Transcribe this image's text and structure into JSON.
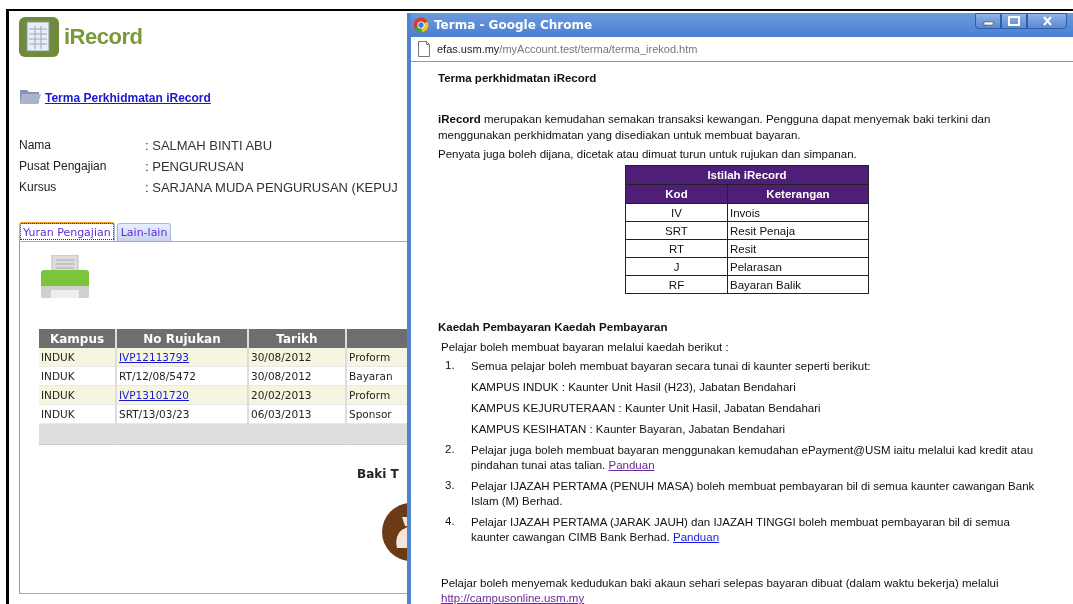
{
  "main_page": {
    "app_title": "iRecord",
    "terms_link": "Terma Perkhidmatan iRecord",
    "profile": [
      {
        "label": "Nama",
        "value": ": SALMAH BINTI ABU"
      },
      {
        "label": "Pusat Pengajian",
        "value": ": PENGURUSAN"
      },
      {
        "label": "Kursus",
        "value": ": SARJANA MUDA PENGURUSAN (KEPUJ"
      }
    ],
    "tabs": [
      {
        "label": "Yuran Pengajian",
        "selected": true
      },
      {
        "label": "Lain-lain",
        "selected": false
      }
    ],
    "table": {
      "columns": [
        "Kampus",
        "No Rujukan",
        "Tarikh"
      ],
      "rows": [
        {
          "cells": [
            "INDUK",
            "IVP12113793",
            "30/08/2012",
            "Proform"
          ],
          "kind": "link"
        },
        {
          "cells": [
            "INDUK",
            "RT/12/08/5472",
            "30/08/2012",
            "Bayaran"
          ],
          "kind": "text"
        },
        {
          "cells": [
            "INDUK",
            "IVP13101720",
            "20/02/2013",
            "Proform"
          ],
          "kind": "link"
        },
        {
          "cells": [
            "INDUK",
            "SRT/13/03/23",
            "06/03/2013",
            "Sponsor"
          ],
          "kind": "text"
        }
      ]
    },
    "balance_label": "Baki T"
  },
  "popup": {
    "title": "Terma - Google Chrome",
    "url_host": "efas.usm.my",
    "url_path": "/myAccount.test/terma/terma_irekod.htm",
    "heading": "Terma perkhidmatan iRecord",
    "intro": "**iRecord** merupakan kemudahan semakan transaksi kewangan. Pengguna dapat menyemak baki terkini dan menggunakan perkhidmatan yang disediakan untuk membuat bayaran.",
    "intro_2": "Penyata juga boleh dijana, dicetak atau dimuat turun untuk rujukan dan simpanan.",
    "terms_table": {
      "title": "Istilah iRecord",
      "columns": [
        "Kod",
        "Keterangan"
      ],
      "rows": [
        [
          "IV",
          "Invois"
        ],
        [
          "SRT",
          "Resit Penaja"
        ],
        [
          "RT",
          "Resit"
        ],
        [
          "J",
          "Pelarasan"
        ],
        [
          "RF",
          "Bayaran Balik"
        ]
      ]
    },
    "payment_heading": "Kaedah Pembayaran Kaedah Pembayaran",
    "payment_intro": "Pelajar boleh membuat bayaran melalui kaedah berikut :",
    "methods": [
      {
        "number": "1.",
        "text": "Semua pelajar boleh membuat bayaran secara tunai di kaunter seperti berikut:",
        "lines": [
          "KAMPUS INDUK : Kaunter Unit Hasil (H23), Jabatan Bendahari",
          "KAMPUS KEJURUTERAAN : Kaunter Unit Hasil, Jabatan Bendahari",
          "KAMPUS KESIHATAN : Kaunter Bayaran, Jabatan Bendahari"
        ]
      },
      {
        "number": "2.",
        "text": "Pelajar juga boleh membuat bayaran menggunakan kemudahan ePayment@USM iaitu melalui kad kredit atau pindahan tunai atas talian.",
        "link": {
          "text": "Panduan",
          "visited": true
        }
      },
      {
        "number": "3.",
        "text": "Pelajar IJAZAH PERTAMA (PENUH MASA) boleh membuat pembayaran bil di semua kaunter cawangan Bank Islam (M) Berhad."
      },
      {
        "number": "4.",
        "text": "Pelajar IJAZAH PERTAMA (JARAK JAUH) dan IJAZAH TINGGI boleh membuat pembayaran bil di semua kaunter cawangan CIMB Bank Berhad.",
        "link": {
          "text": "Panduan",
          "visited": false
        }
      }
    ],
    "footer_text": "Pelajar boleh menyemak kedudukan baki akaun sehari selepas bayaran dibuat (dalam waktu bekerja) melalui",
    "footer_link": {
      "text": "http://campusonline.usm.my",
      "visited": true
    }
  }
}
